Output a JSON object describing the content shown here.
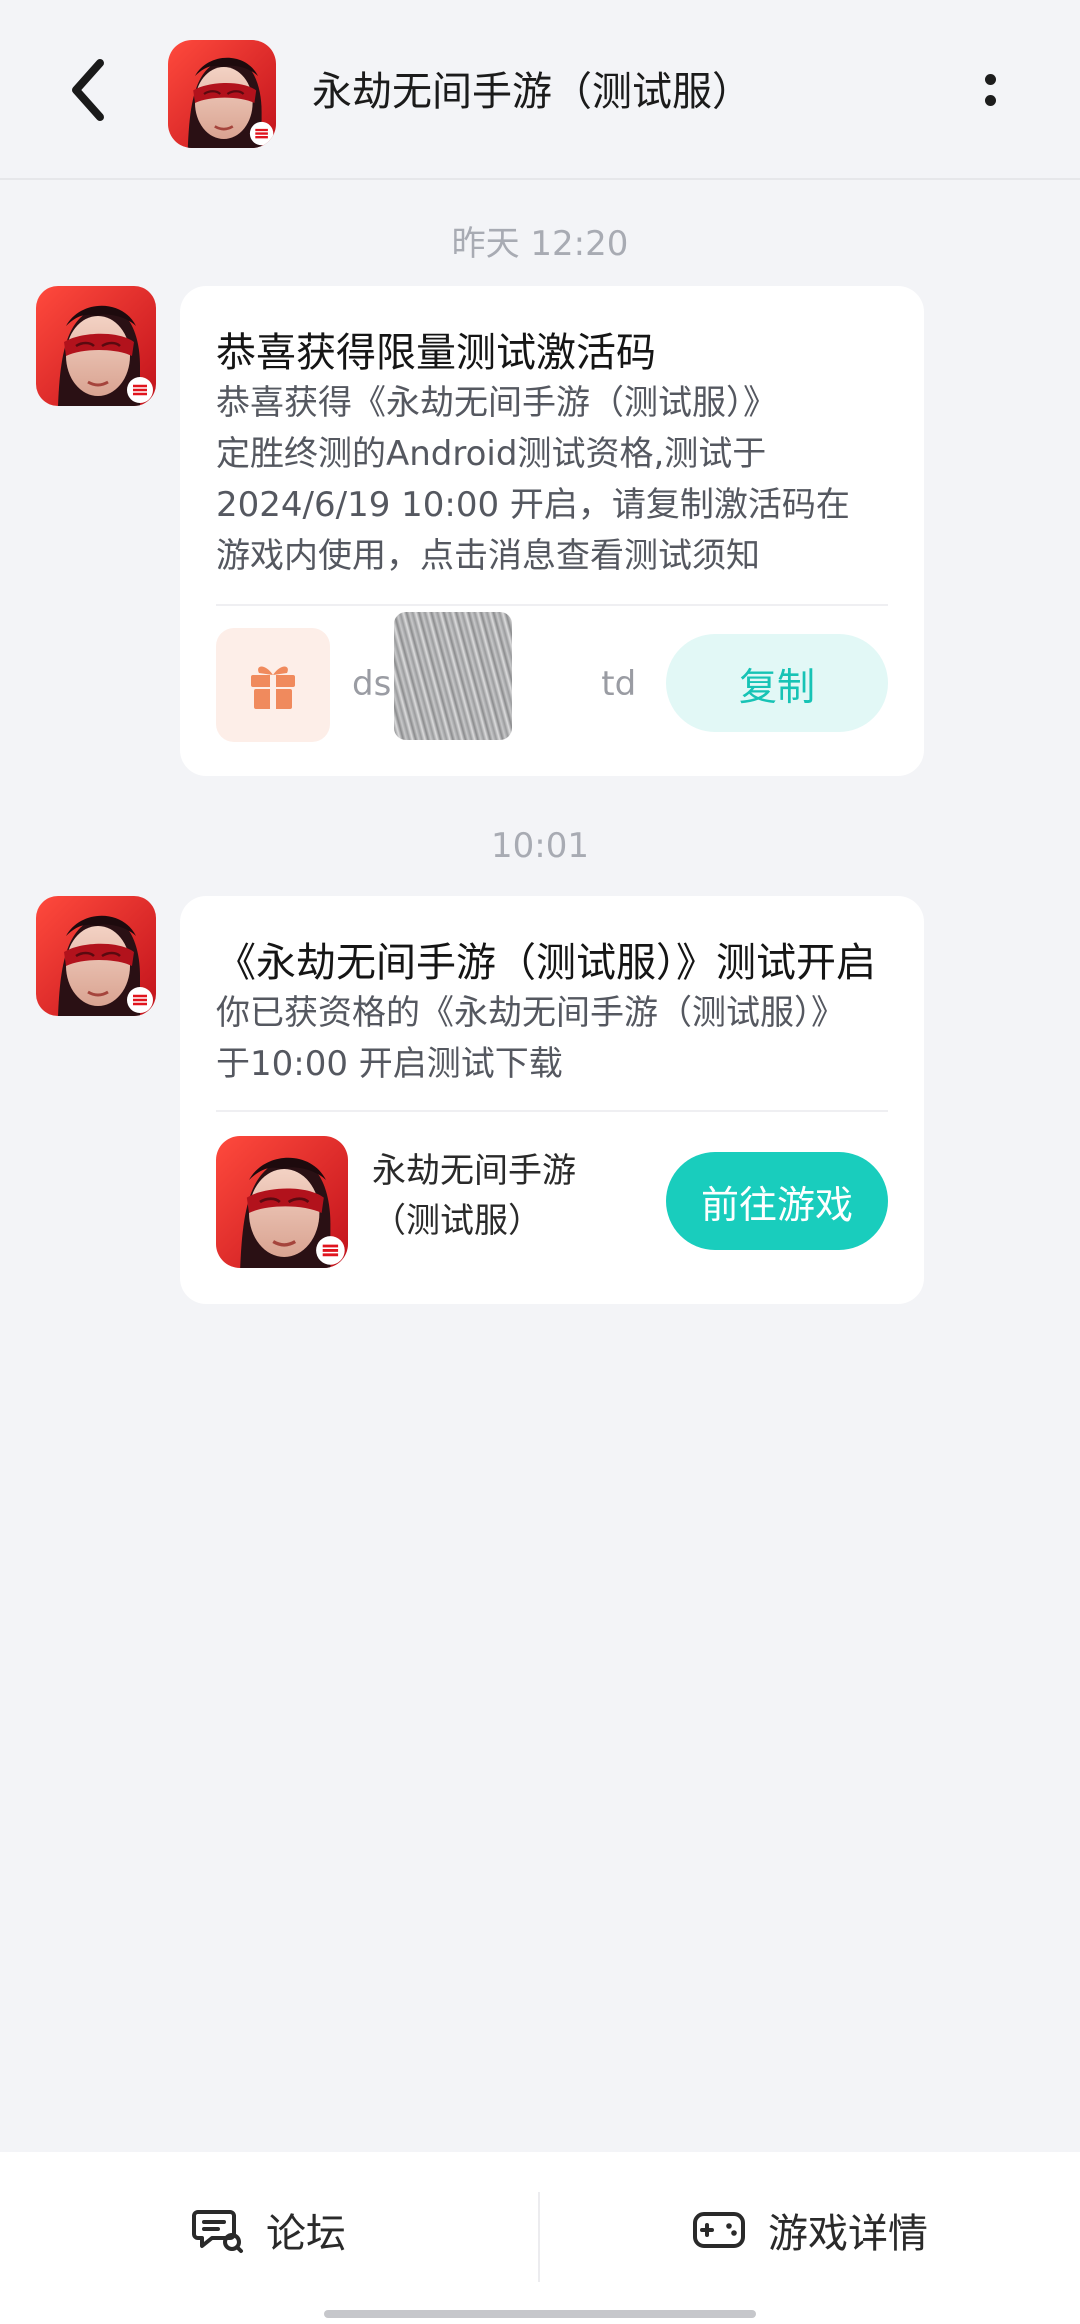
{
  "header": {
    "back_icon": "chevron-left-icon",
    "title": "永劫无间手游（测试服）",
    "more_icon": "more-vertical-icon"
  },
  "messages": [
    {
      "timestamp": "昨天  12:20",
      "title": "恭喜获得限量测试激活码",
      "body_lines": [
        "恭喜获得《永劫无间手游（测试服）》",
        "定胜终测的Android测试资格,测试于",
        "2024/6/19 10:00 开启，请复制激活码在",
        "游戏内使用，点击消息查看测试须知"
      ],
      "gift_icon": "gift-icon",
      "code_prefix": "ds",
      "code_suffix": "td",
      "copy_label": "复制"
    },
    {
      "timestamp": "10:01",
      "title": "《永劫无间手游（测试服）》测试开启",
      "body_lines": [
        "你已获资格的《永劫无间手游（测试服）》",
        "于10:00 开启测试下载"
      ],
      "game_name_lines": [
        "永劫无间手游",
        "（测试服）"
      ],
      "go_label": "前往游戏"
    }
  ],
  "bottom_bar": {
    "forum_label": "论坛",
    "forum_icon": "chat-bubble-icon",
    "details_label": "游戏详情",
    "details_icon": "gamepad-icon"
  },
  "colors": {
    "accent": "#19cdbd",
    "accent_light": "#e2f8f6",
    "gift": "#f08a5d",
    "background": "#f3f4f7"
  }
}
